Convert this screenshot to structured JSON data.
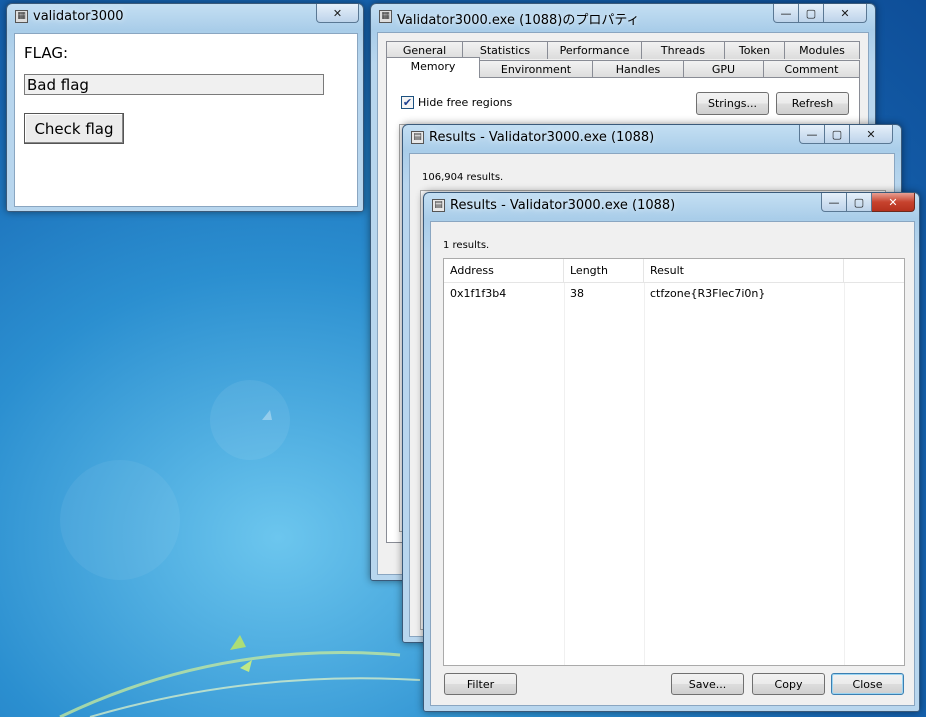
{
  "validator_window": {
    "title": "validator3000",
    "flag_label": "FLAG:",
    "flag_value": "Bad flag",
    "check_button": "Check flag",
    "close_glyph": "✕"
  },
  "properties_window": {
    "title": "Validator3000.exe (1088)のプロパティ",
    "tabs_row1": [
      "General",
      "Statistics",
      "Performance",
      "Threads",
      "Token",
      "Modules"
    ],
    "tabs_row2": [
      "Memory",
      "Environment",
      "Handles",
      "GPU",
      "Comment"
    ],
    "active_tab": "Memory",
    "hide_free_label": "Hide free regions",
    "hide_free_checked": true,
    "strings_button": "Strings...",
    "refresh_button": "Refresh",
    "min_glyph": "—",
    "max_glyph": "▢",
    "close_glyph": "✕"
  },
  "results_back": {
    "title": "Results - Validator3000.exe (1088)",
    "count": "106,904 results.",
    "min_glyph": "—",
    "max_glyph": "▢",
    "close_glyph": "✕"
  },
  "results_front": {
    "title": "Results - Validator3000.exe (1088)",
    "count": "1 results.",
    "columns": [
      "Address",
      "Length",
      "Result"
    ],
    "rows": [
      {
        "address": "0x1f1f3b4",
        "length": "38",
        "result": "ctfzone{R3Flec7i0n}"
      }
    ],
    "filter_button": "Filter",
    "save_button": "Save...",
    "copy_button": "Copy",
    "close_button": "Close",
    "min_glyph": "—",
    "max_glyph": "▢",
    "close_glyph": "✕"
  },
  "colors": {
    "desktop": "#1767b4",
    "frame": "#b8d6ee",
    "close_red": "#c7432e"
  },
  "icons": [
    "app-icon",
    "checkbox-icon",
    "list-icon"
  ]
}
